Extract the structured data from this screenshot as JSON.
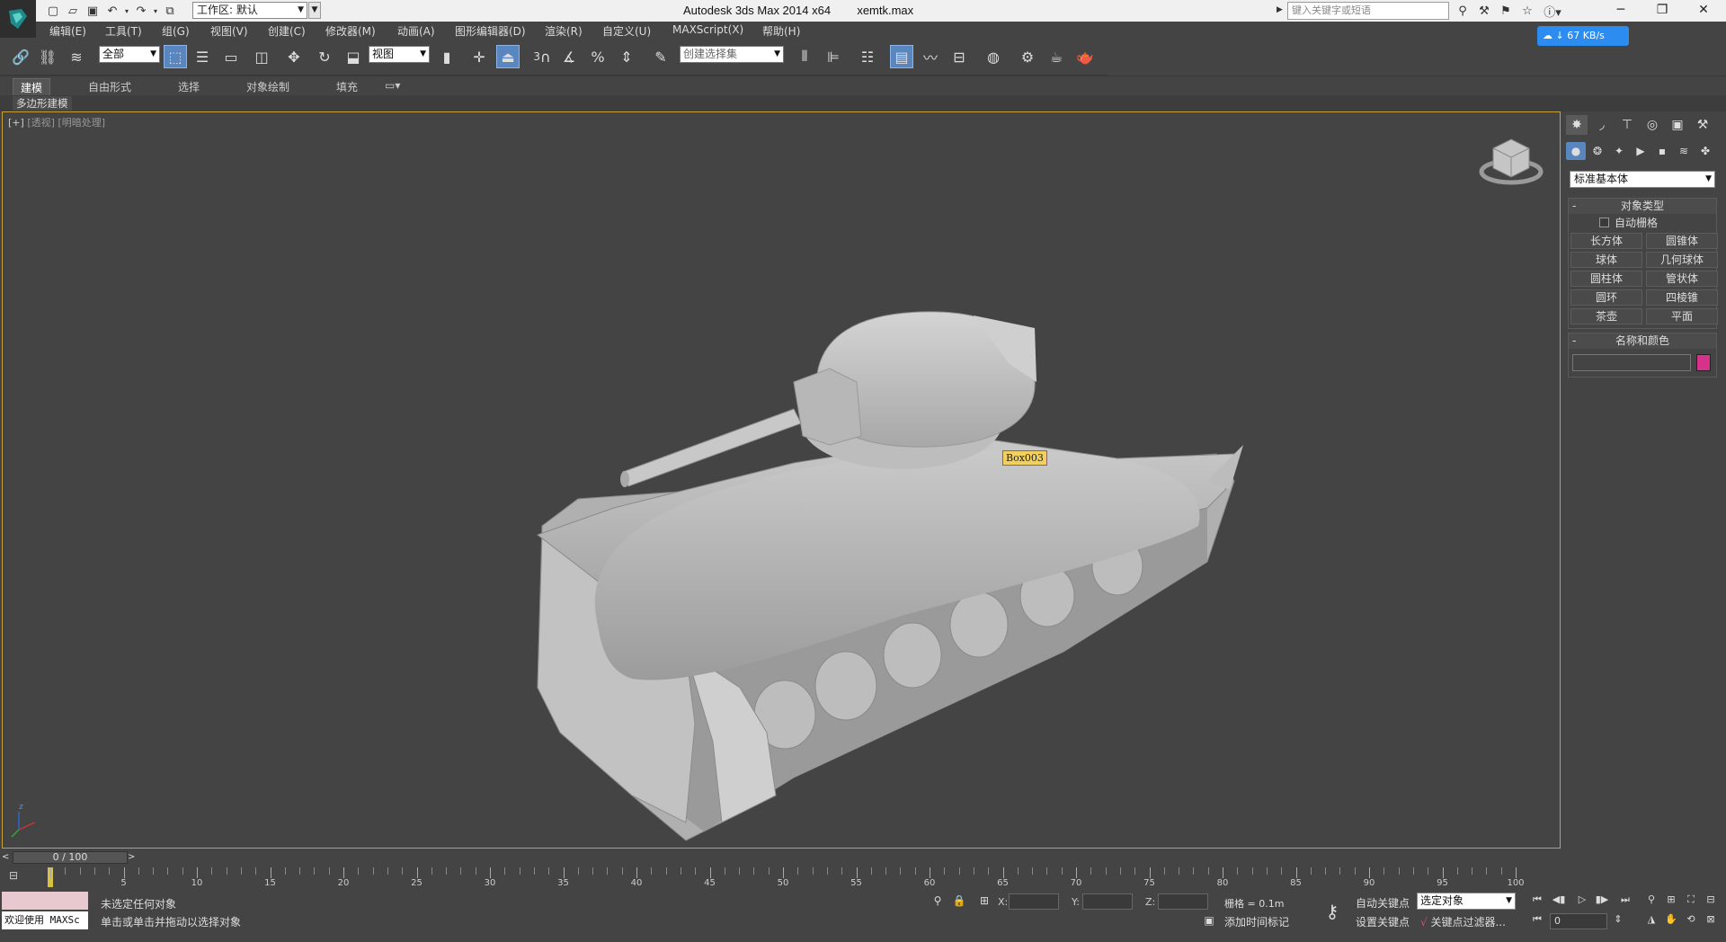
{
  "window": {
    "app_title": "Autodesk 3ds Max  2014 x64",
    "file_name": "xemtk.max",
    "workspace_label": "工作区: 默认",
    "search_placeholder": "键入关键字或短语"
  },
  "menu": [
    "编辑(E)",
    "工具(T)",
    "组(G)",
    "视图(V)",
    "创建(C)",
    "修改器(M)",
    "动画(A)",
    "图形编辑器(D)",
    "渲染(R)",
    "自定义(U)",
    "MAXScript(X)",
    "帮助(H)"
  ],
  "toolbar": {
    "filter_value": "全部",
    "ref_coord_value": "视图",
    "snap_label": "3",
    "named_selection_placeholder": "创建选择集"
  },
  "network_badge": "67 KB/s",
  "ribbon": {
    "tabs": [
      "建模",
      "自由形式",
      "选择",
      "对象绘制",
      "填充"
    ],
    "active_tab": "建模",
    "sub_label": "多边形建模"
  },
  "viewport": {
    "label_plus": "[+]",
    "label_view": "[透视]",
    "label_shading": "[明暗处理]",
    "object_tag": "Box003"
  },
  "command_panel": {
    "category": "标准基本体",
    "object_type_title": "对象类型",
    "auto_grid": "自动栅格",
    "buttons": [
      "长方体",
      "圆锥体",
      "球体",
      "几何球体",
      "圆柱体",
      "管状体",
      "圆环",
      "四棱锥",
      "茶壶",
      "平面"
    ],
    "name_color_title": "名称和颜色",
    "object_color": "#d6328a"
  },
  "timeline": {
    "frame_range": "0 / 100",
    "ticks": [
      5,
      10,
      15,
      20,
      25,
      30,
      35,
      40,
      45,
      50,
      55,
      60,
      65,
      70,
      75,
      80,
      85,
      90,
      95,
      100
    ],
    "max_frame": 100
  },
  "status": {
    "maxscript_text": "欢迎使用 MAXSc",
    "line1": "未选定任何对象",
    "line2": "单击或单击并拖动以选择对象",
    "x_label": "X:",
    "y_label": "Y:",
    "z_label": "Z:",
    "grid": "栅格 = 0.1m",
    "add_time_tag": "添加时间标记",
    "auto_key": "自动关键点",
    "set_key": "设置关键点",
    "selection_filter": "选定对象",
    "key_filters": "关键点过滤器...",
    "current_frame": "0"
  }
}
